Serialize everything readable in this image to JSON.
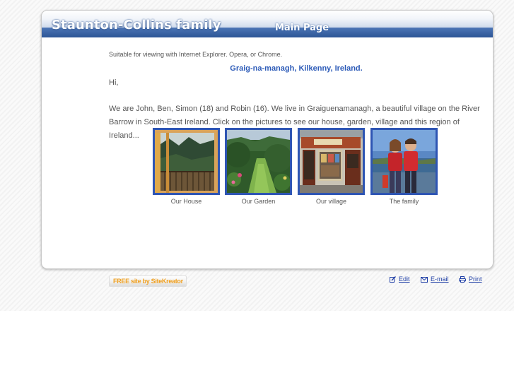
{
  "header": {
    "site_title": "Staunton-Collins family",
    "page_title": "Main Page"
  },
  "content": {
    "browser_note": "Suitable for viewing with Internet Explorer. Opera, or Chrome.",
    "location": "Graig-na-managh, Kilkenny, Ireland.",
    "greeting": "Hi,",
    "intro": "We are John, Ben, Simon (18) and Robin (16). We live in Graiguenamanagh, a beautiful village on the River Barrow in South-East Ireland. Click on the pictures to see our house, garden, village and this region of Ireland..."
  },
  "gallery": [
    {
      "caption": "Our House",
      "icon": "house-photo"
    },
    {
      "caption": "Our Garden",
      "icon": "garden-photo"
    },
    {
      "caption": "Our village",
      "icon": "village-photo"
    },
    {
      "caption": "The family",
      "icon": "family-photo"
    }
  ],
  "footer": {
    "badge": "FREE site by SiteKreator",
    "links": {
      "edit": "Edit",
      "email": "E-mail",
      "print": "Print"
    }
  },
  "colors": {
    "header_blue": "#2c5596",
    "frame_blue": "#2e55b3",
    "location_text": "#2d5bb8",
    "link": "#1f3fa6",
    "badge_orange": "#f0a020"
  }
}
